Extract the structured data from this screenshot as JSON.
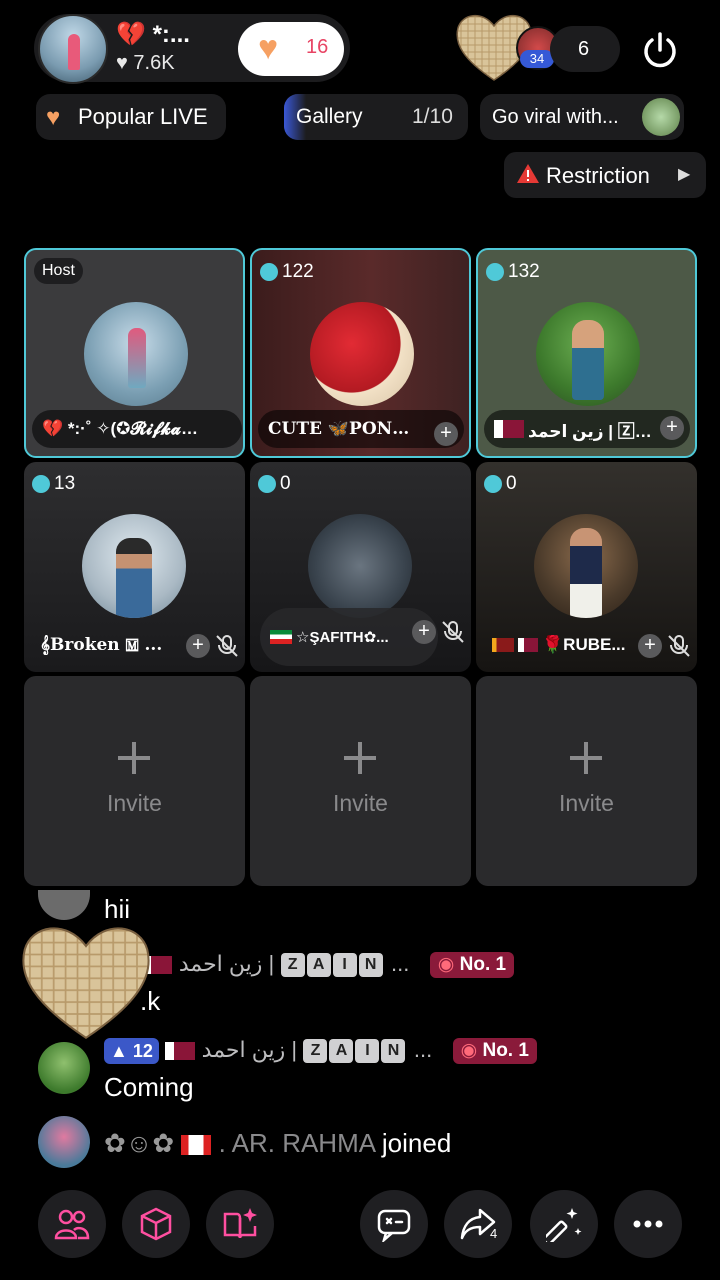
{
  "header": {
    "host_name": "*:...",
    "host_likes": "♥ 7.6K",
    "follow_count": "16",
    "viewer_level": "34",
    "viewer_count": "6"
  },
  "pills": {
    "popular": "Popular LIVE",
    "gallery": "Gallery",
    "gallery_count": "1/10",
    "viral": "Go viral with...",
    "restriction": "Restriction"
  },
  "grid": {
    "host_badge": "Host",
    "seats": [
      {
        "score": "",
        "name": "💔 *:·˚ ✧(✪𝓡𝓲𝓯𝓴𝓪✪)*..."
      },
      {
        "score": "122",
        "name": "CUTE 🦋PONN..."
      },
      {
        "score": "132",
        "name": "زين احمد | 🅉🄰 ..."
      },
      {
        "score": "13",
        "name": "𝄞Broken 🄼 ..."
      },
      {
        "score": "0",
        "name": "☆ŞAFITH✿..."
      },
      {
        "score": "0",
        "name": "🌹RUBE..."
      }
    ],
    "invite_label": "Invite"
  },
  "chat": {
    "partial_msg": "hii",
    "user_level": "12",
    "user_name": "زين احمد |",
    "zain_letters": [
      "Z",
      "A",
      "I",
      "N"
    ],
    "ellipsis": "...",
    "rank": "No. 1",
    "msg1": ".k",
    "msg2": "Coming",
    "join_name": "AR. RAHMA",
    "join_suffix": "joined",
    "join_prefix": "."
  },
  "toolbar": {
    "share_count": "4"
  },
  "colors": {
    "accent_cyan": "#4fc9d8",
    "level_blue": "#3b58c8",
    "rank_bg": "#8a1a3a",
    "heart_orange": "#f6a062",
    "alert_red": "#e53935"
  },
  "icons": [
    "broken-heart-icon",
    "heart-icon",
    "disco-heart-icon",
    "power-icon",
    "warning-icon",
    "chevron-right-icon",
    "plus-icon",
    "mic-off-icon",
    "people-icon",
    "cube-icon",
    "book-sparkle-icon",
    "chat-icon",
    "share-icon",
    "magic-wand-icon",
    "more-icon"
  ]
}
